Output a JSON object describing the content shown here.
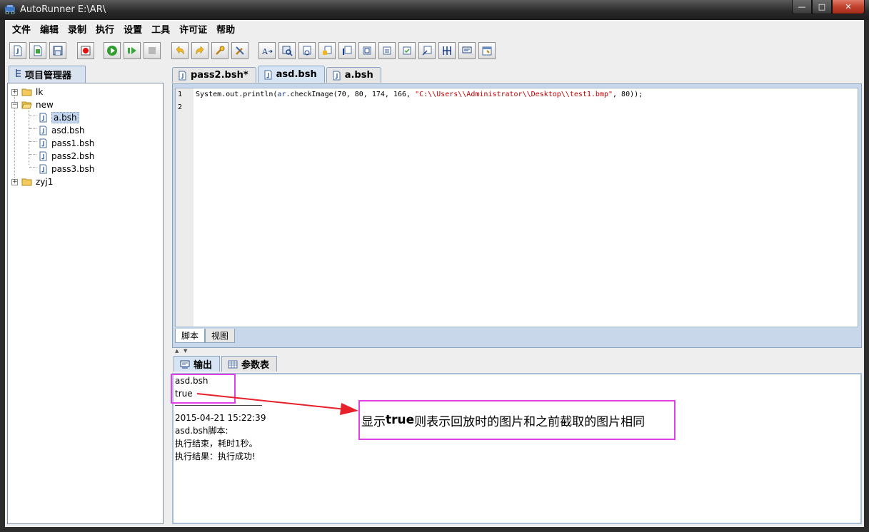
{
  "window": {
    "title": "AutoRunner  E:\\AR\\",
    "min_label": "—",
    "max_label": "□",
    "close_label": "✕"
  },
  "menu": [
    "文件",
    "编辑",
    "录制",
    "执行",
    "设置",
    "工具",
    "许可证",
    "帮助"
  ],
  "toolbar": {
    "icons": [
      "new-script-icon",
      "open-icon",
      "save-icon",
      "record-icon",
      "run-icon",
      "run-step-icon",
      "stop-icon",
      "undo-icon",
      "redo-icon",
      "wrench-icon",
      "settings-wrench-icon",
      "text-icon",
      "search-image-icon",
      "checkpoint-icon",
      "check-icon-1",
      "check-icon-2",
      "check-icon-3",
      "check-icon-4",
      "check-icon-5",
      "check-icon-6",
      "columns-icon",
      "comment-icon",
      "properties-icon"
    ]
  },
  "project_panel": {
    "tab_label": "项目管理器",
    "tree": [
      {
        "label": "lk",
        "type": "folder",
        "expanded": false
      },
      {
        "label": "new",
        "type": "folder",
        "expanded": true
      },
      {
        "label": "a.bsh",
        "type": "file",
        "selected": true
      },
      {
        "label": "asd.bsh",
        "type": "file"
      },
      {
        "label": "pass1.bsh",
        "type": "file"
      },
      {
        "label": "pass2.bsh",
        "type": "file"
      },
      {
        "label": "pass3.bsh",
        "type": "file"
      },
      {
        "label": "zyj1",
        "type": "folder",
        "expanded": false
      }
    ]
  },
  "editor": {
    "tabs": [
      {
        "label": "pass2.bsh*",
        "active": false
      },
      {
        "label": "asd.bsh",
        "active": true
      },
      {
        "label": "a.bsh",
        "active": false
      }
    ],
    "line_numbers": [
      "1",
      "2"
    ],
    "code": {
      "prefix": "System.out.println(",
      "obj": "ar",
      "call": ".checkImage(70, 80, 174, 166, ",
      "string": "\"C:\\\\Users\\\\Administrator\\\\Desktop\\\\test1.bmp\"",
      "suffix": ", 80));"
    },
    "view_tabs": [
      {
        "label": "脚本",
        "active": true
      },
      {
        "label": "视图",
        "active": false
      }
    ]
  },
  "output": {
    "tabs": [
      {
        "label": "输出",
        "active": true
      },
      {
        "label": "参数表",
        "active": false
      }
    ],
    "lines_top": [
      "asd.bsh",
      "true"
    ],
    "lines_bottom": [
      "2015-04-21 15:22:39",
      "asd.bsh脚本:",
      "执行结束，耗时1秒。",
      "执行结果：执行成功!"
    ]
  },
  "annotation": {
    "prefix": "显示",
    "bold": "true",
    "suffix": "则表示回放时的图片和之前截取的图片相同",
    "color": "#e040e6",
    "arrow_color": "#e8202a"
  }
}
